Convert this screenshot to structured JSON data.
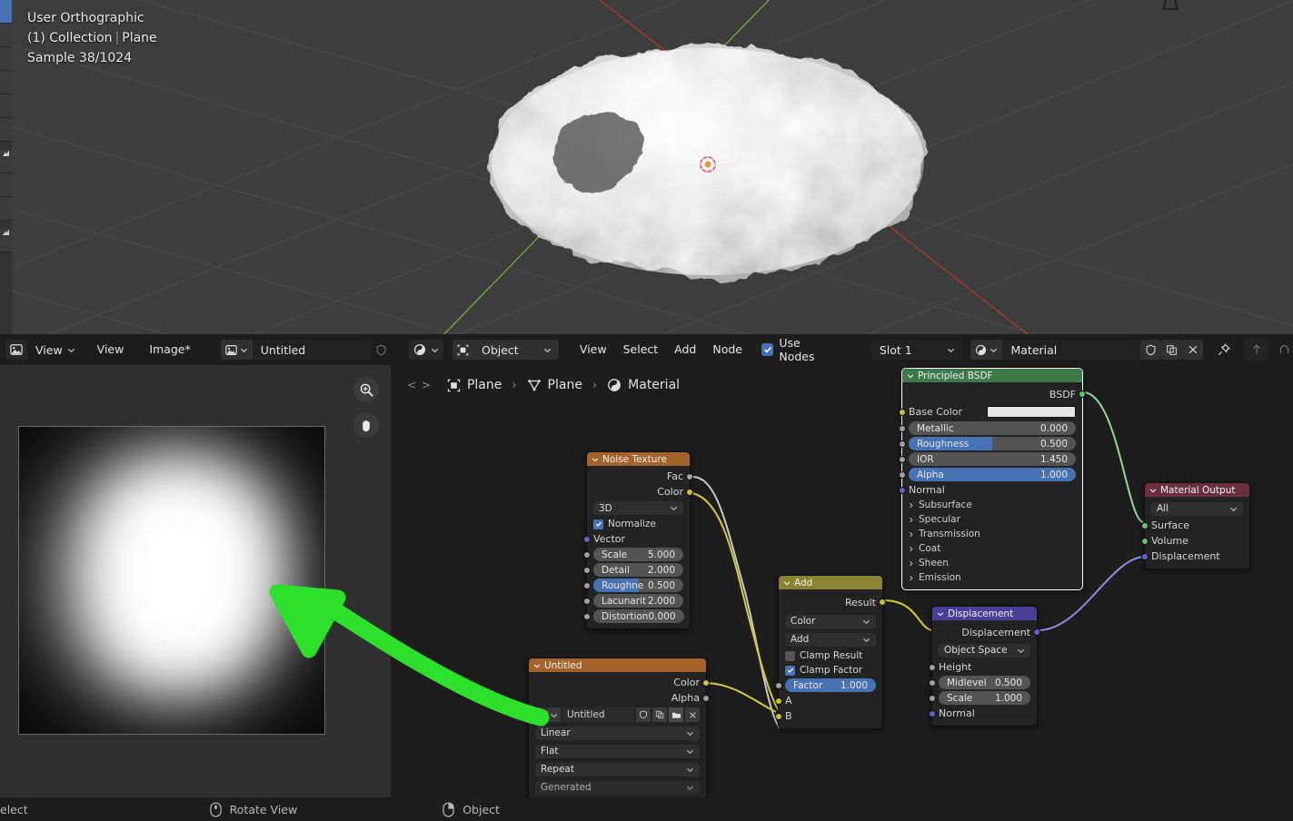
{
  "viewport": {
    "view_mode": "User Orthographic",
    "collection": "(1) Collection",
    "separator": "|",
    "object": "Plane",
    "sample": "Sample 38/1024"
  },
  "image_editor_header": {
    "editor_icon": "image-editor-icon",
    "view_menu_with_chevron": "View",
    "view_menu": "View",
    "image_menu": "Image*",
    "datablock_icon": "image-datablock-icon",
    "datablock_name": "Untitled"
  },
  "node_header": {
    "editor_icon": "shader-editor-icon",
    "shader_type_icon": "object-icon",
    "shader_type": "Object",
    "menus": [
      "View",
      "Select",
      "Add",
      "Node"
    ],
    "use_nodes_label": "Use Nodes",
    "use_nodes_checked": true,
    "slot": "Slot 1",
    "material_icon": "material-icon",
    "material_name": "Material",
    "fake_user_icon": "shield-icon",
    "new_material_icon": "duplicate-icon",
    "unlink_icon": "close-icon",
    "pin_icon": "pin-icon",
    "up_icon": "arrow-up-icon"
  },
  "breadcrumb": {
    "zoom_icon": "zoom-tool-icon",
    "pan_icon": "pan-tool-icon",
    "prev_next": "<  >",
    "items": [
      {
        "icon": "object-icon",
        "label": "Plane"
      },
      {
        "icon": "mesh-data-icon",
        "label": "Plane"
      },
      {
        "icon": "material-icon",
        "label": "Material"
      }
    ],
    "separator": "›"
  },
  "nodes": [
    {
      "id": "noise-texture",
      "title": "Noise Texture",
      "header_color": "#a3632a",
      "outputs": [
        {
          "label": "Fac",
          "color": "#a1a1a1"
        },
        {
          "label": "Color",
          "color": "#c7c729"
        }
      ],
      "dropdowns": [
        "3D"
      ],
      "checkbox": {
        "label": "Normalize",
        "checked": true
      },
      "inputs": [
        {
          "label": "Vector",
          "color": "#6363c7",
          "type": "socket"
        }
      ],
      "sliders": [
        {
          "label": "Scale",
          "value": "5.000",
          "style": "plain",
          "color": "#6363c7"
        },
        {
          "label": "Detail",
          "value": "2.000",
          "style": "plain",
          "color": "#a1a1a1"
        },
        {
          "label": "Roughne",
          "value": "0.500",
          "style": "half",
          "color": "#a1a1a1"
        },
        {
          "label": "Lacunarit",
          "value": "2.000",
          "style": "plain",
          "color": "#a1a1a1"
        },
        {
          "label": "Distortion",
          "value": "0.000",
          "style": "plain",
          "color": "#a1a1a1"
        }
      ]
    },
    {
      "id": "image-texture",
      "title": "Untitled",
      "header_color": "#a3632a",
      "outputs": [
        {
          "label": "Color",
          "color": "#c7c729"
        },
        {
          "label": "Alpha",
          "color": "#a1a1a1"
        }
      ],
      "datablock": {
        "icon": "image-datablock-icon",
        "name": "Untitled",
        "buttons": [
          "shield-icon",
          "duplicate-icon",
          "folder-icon",
          "close-icon"
        ]
      },
      "dropdowns": [
        "Linear",
        "Flat",
        "Repeat",
        "Generated"
      ]
    },
    {
      "id": "mix-color-add",
      "title": "Add",
      "header_color": "#8a8332",
      "outputs": [
        {
          "label": "Result",
          "color": "#c7c729"
        }
      ],
      "dropdowns": [
        "Color",
        "Add"
      ],
      "checkboxes": [
        {
          "label": "Clamp Result",
          "checked": false
        },
        {
          "label": "Clamp Factor",
          "checked": true
        }
      ],
      "sliders": [
        {
          "label": "Factor",
          "value": "1.000",
          "style": "full",
          "color": "#a1a1a1"
        }
      ],
      "inputs": [
        {
          "label": "A",
          "color": "#c7c729"
        },
        {
          "label": "B",
          "color": "#c7c729"
        }
      ]
    },
    {
      "id": "principled-bsdf",
      "title": "Principled BSDF",
      "header_color": "#3d7a4a",
      "selected": true,
      "outputs": [
        {
          "label": "BSDF",
          "color": "#62c462"
        }
      ],
      "color_row": {
        "label": "Base Color",
        "color": "#e6e6e6",
        "socket": "#c7c729"
      },
      "sliders": [
        {
          "label": "Metallic",
          "value": "0.000",
          "style": "plain",
          "color": "#a1a1a1"
        },
        {
          "label": "Roughness",
          "value": "0.500",
          "style": "half",
          "color": "#a1a1a1"
        },
        {
          "label": "IOR",
          "value": "1.450",
          "style": "plain",
          "color": "#a1a1a1"
        },
        {
          "label": "Alpha",
          "value": "1.000",
          "style": "full",
          "color": "#a1a1a1"
        }
      ],
      "inputs": [
        {
          "label": "Normal",
          "color": "#6363c7"
        }
      ],
      "panels": [
        "Subsurface",
        "Specular",
        "Transmission",
        "Coat",
        "Sheen",
        "Emission"
      ]
    },
    {
      "id": "displacement",
      "title": "Displacement",
      "header_color": "#4a3f96",
      "outputs": [
        {
          "label": "Displacement",
          "color": "#6363c7"
        }
      ],
      "dropdowns": [
        "Object Space"
      ],
      "inputs": [
        {
          "label": "Height",
          "color": "#a1a1a1"
        },
        {
          "label": "Normal",
          "color": "#6363c7"
        }
      ],
      "sliders": [
        {
          "label": "Midlevel",
          "value": "0.500",
          "style": "plain",
          "color": "#a1a1a1"
        },
        {
          "label": "Scale",
          "value": "1.000",
          "style": "plain",
          "color": "#a1a1a1"
        }
      ]
    },
    {
      "id": "material-output",
      "title": "Material Output",
      "header_color": "#6b3040",
      "dropdowns": [
        "All"
      ],
      "inputs": [
        {
          "label": "Surface",
          "color": "#62c462"
        },
        {
          "label": "Volume",
          "color": "#62c462"
        },
        {
          "label": "Displacement",
          "color": "#6363c7"
        }
      ]
    }
  ],
  "statusbar": {
    "select": "elect",
    "rotate_view": "Rotate View",
    "object": "Object",
    "mouse_mid_icon": "mouse-middle-icon",
    "mouse_right_icon": "mouse-right-icon"
  },
  "annotation": {
    "arrow_color": "#2ce02c",
    "points": "pointing at image canvas"
  }
}
